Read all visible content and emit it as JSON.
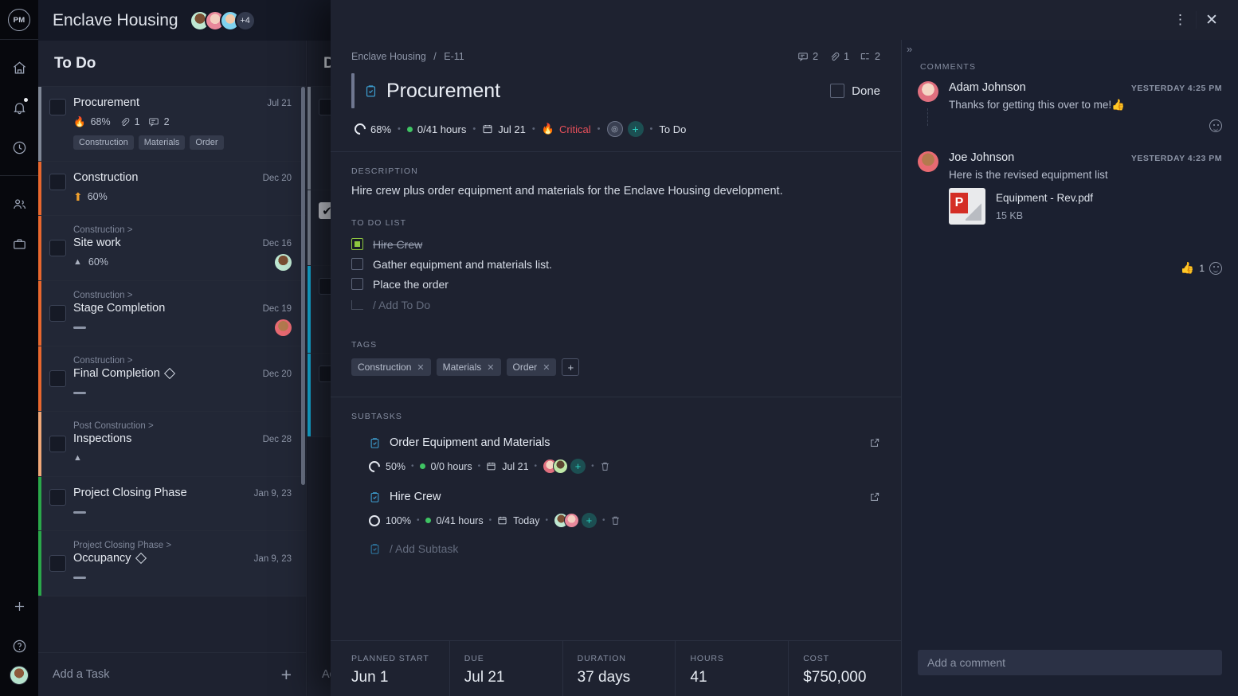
{
  "rail": {
    "logo": "PM",
    "items": [
      {
        "name": "home-icon",
        "label": "Home"
      },
      {
        "name": "bell-icon",
        "label": "Notifications"
      },
      {
        "name": "clock-icon",
        "label": "Recent"
      },
      {
        "name": "people-icon",
        "label": "People"
      },
      {
        "name": "briefcase-icon",
        "label": "Portfolio"
      }
    ],
    "add_label": "+",
    "help_label": "?"
  },
  "header": {
    "project_title": "Enclave Housing",
    "avatar_overflow": "+4"
  },
  "board": {
    "columns": [
      {
        "title": "To Do",
        "add_label": "Add a Task"
      },
      {
        "title": "Done",
        "add_label": "Add a Task"
      }
    ],
    "tasks": [
      {
        "parent": "",
        "name": "Procurement",
        "date": "Jul 21",
        "progress": "68%",
        "priority_icon": "fire-icon",
        "attachments": "1",
        "comments": "2",
        "tags": [
          "Construction",
          "Materials",
          "Order"
        ],
        "bar_color": "#7f8796",
        "milestone": false
      },
      {
        "parent": "",
        "name": "Construction",
        "date": "Dec 20",
        "progress": "60%",
        "priority_icon": "up-arrow-icon",
        "bar_color": "#e8672e",
        "milestone": false
      },
      {
        "parent": "Construction >",
        "name": "Site work",
        "date": "Dec 16",
        "progress": "60%",
        "priority_icon": "triangle-up-icon",
        "bar_color": "#e8672e",
        "avatar": "green",
        "milestone": false
      },
      {
        "parent": "Construction >",
        "name": "Stage Completion",
        "date": "Dec 19",
        "progress": "",
        "priority_icon": "dash-icon",
        "bar_color": "#e8672e",
        "avatar": "red",
        "milestone": false
      },
      {
        "parent": "Construction >",
        "name": "Final Completion",
        "date": "Dec 20",
        "progress": "",
        "priority_icon": "dash-icon",
        "bar_color": "#e8672e",
        "milestone": true
      },
      {
        "parent": "Post Construction >",
        "name": "Inspections",
        "date": "Dec 28",
        "progress": "",
        "priority_icon": "triangle-up-icon",
        "bar_color": "#f0a878",
        "milestone": false
      },
      {
        "parent": "",
        "name": "Project Closing Phase",
        "date": "Jan 9, 23",
        "progress": "",
        "priority_icon": "dash-icon",
        "bar_color": "#2aa84a",
        "milestone": false
      },
      {
        "parent": "Project Closing Phase >",
        "name": "Occupancy",
        "date": "Jan 9, 23",
        "progress": "",
        "priority_icon": "dash-icon",
        "bar_color": "#2aa84a",
        "milestone": true
      }
    ]
  },
  "modal": {
    "breadcrumb": {
      "project": "Enclave Housing",
      "separator": "/",
      "code": "E-11"
    },
    "counts": {
      "comments": "2",
      "attachments": "1",
      "subtasks": "2"
    },
    "title": "Procurement",
    "done_label": "Done",
    "meta": {
      "progress": "68%",
      "hours": "0/41 hours",
      "date": "Jul 21",
      "priority": "Critical",
      "status": "To Do"
    },
    "description_label": "DESCRIPTION",
    "description": "Hire crew plus order equipment and materials for the Enclave Housing development.",
    "todo_label": "TO DO LIST",
    "todos": [
      {
        "text": "Hire Crew",
        "checked": true
      },
      {
        "text": "Gather equipment and materials list.",
        "checked": false
      },
      {
        "text": "Place the order",
        "checked": false
      }
    ],
    "todo_add_placeholder": "/ Add To Do",
    "tags_label": "TAGS",
    "tags": [
      "Construction",
      "Materials",
      "Order"
    ],
    "tag_add_label": "+",
    "subtasks_label": "SUBTASKS",
    "subtasks": [
      {
        "name": "Order Equipment and Materials",
        "progress": "50%",
        "hours": "0/0 hours",
        "date": "Jul 21"
      },
      {
        "name": "Hire Crew",
        "progress": "100%",
        "hours": "0/41 hours",
        "date": "Today"
      }
    ],
    "subtask_add_placeholder": "/ Add Subtask",
    "fields": [
      {
        "label": "PLANNED START",
        "value": "Jun 1"
      },
      {
        "label": "DUE",
        "value": "Jul 21"
      },
      {
        "label": "DURATION",
        "value": "37 days"
      },
      {
        "label": "HOURS",
        "value": "41"
      },
      {
        "label": "COST",
        "value": "$750,000"
      }
    ]
  },
  "comments_panel": {
    "collapse_label": "»",
    "label": "COMMENTS",
    "items": [
      {
        "author": "Adam Johnson",
        "time": "YESTERDAY 4:25 PM",
        "text": "Thanks for getting this over to me!👍"
      },
      {
        "author": "Joe Johnson",
        "time": "YESTERDAY 4:23 PM",
        "text": "Here is the revised equipment list",
        "attachment": {
          "name": "Equipment - Rev.pdf",
          "size": "15 KB",
          "type": "pdf"
        },
        "reaction": {
          "emoji": "👍",
          "count": "1"
        }
      }
    ],
    "input_placeholder": "Add a comment"
  },
  "colors": {
    "accent_blue": "#3d9fd1",
    "critical_red": "#e8505b",
    "green": "#3fc463",
    "teal": "#2ad0c0",
    "checkbox_green": "#8dc63f"
  }
}
